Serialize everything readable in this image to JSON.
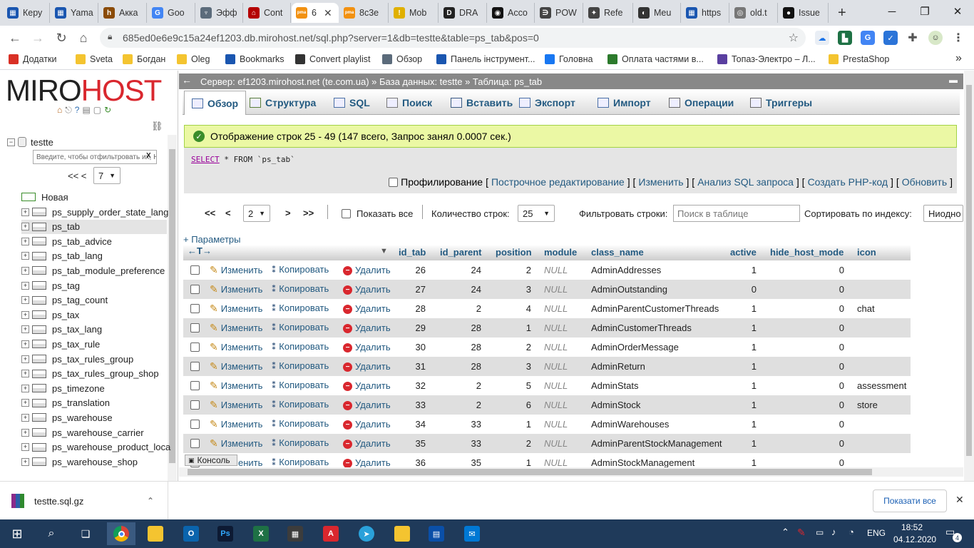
{
  "browser": {
    "tabs": [
      {
        "label": "Керу",
        "icon_color": "#1a56b0",
        "icon_char": "▦"
      },
      {
        "label": "Yama",
        "icon_color": "#1a56b0",
        "icon_char": "▦"
      },
      {
        "label": "Акка",
        "icon_color": "#8a4b08",
        "icon_char": "h"
      },
      {
        "label": "Goo",
        "icon_color": "#4285f4",
        "icon_char": "G"
      },
      {
        "label": "Эфф",
        "icon_color": "#5b6b7b",
        "icon_char": "♆"
      },
      {
        "label": "Cont",
        "icon_color": "#b40000",
        "icon_char": "⌂"
      },
      {
        "label": "6",
        "icon_color": "#f29111",
        "icon_char": "pma"
      },
      {
        "label": "8с3е",
        "icon_color": "#f29111",
        "icon_char": "pma"
      },
      {
        "label": "Mob",
        "icon_color": "#e0b000",
        "icon_char": "!"
      },
      {
        "label": "DRA",
        "icon_color": "#222222",
        "icon_char": "D"
      },
      {
        "label": "Acco",
        "icon_color": "#111111",
        "icon_char": "◉"
      },
      {
        "label": "POW",
        "icon_color": "#444444",
        "icon_char": "∋"
      },
      {
        "label": "Refe",
        "icon_color": "#444444",
        "icon_char": "✦"
      },
      {
        "label": "Meu",
        "icon_color": "#333333",
        "icon_char": "◐"
      },
      {
        "label": "https",
        "icon_color": "#1a56b0",
        "icon_char": "▦"
      },
      {
        "label": "old.t",
        "icon_color": "#777777",
        "icon_char": "◎"
      },
      {
        "label": "Issue",
        "icon_color": "#111111",
        "icon_char": "●"
      }
    ],
    "new_tab": "+",
    "url": "685ed0e6e9c15a24ef1203.db.mirohost.net/sql.php?server=1&db=testte&table=ps_tab&pos=0",
    "bookmarks": [
      {
        "label": "Додатки",
        "color": "#d93025"
      },
      {
        "label": "Sveta",
        "color": "#f4c430"
      },
      {
        "label": "Богдан",
        "color": "#f4c430"
      },
      {
        "label": "Oleg",
        "color": "#f4c430"
      },
      {
        "label": "Bookmarks",
        "color": "#1a56b0"
      },
      {
        "label": "Convert playlist",
        "color": "#333333"
      },
      {
        "label": "Обзор",
        "color": "#5b6b7b"
      },
      {
        "label": "Панель інструмент...",
        "color": "#1a56b0"
      },
      {
        "label": "Головна",
        "color": "#1877f2"
      },
      {
        "label": "Оплата частями в...",
        "color": "#2c7a2c"
      },
      {
        "label": "Топаз-Электро – Л...",
        "color": "#5a3fa0"
      },
      {
        "label": "PrestaShop",
        "color": "#f4c430"
      }
    ],
    "more_bookmarks": "»"
  },
  "nav": {
    "logo_a": "MIRO",
    "logo_b": "HOST",
    "db_name": "testte",
    "filter_placeholder": "Введите, чтобы отфильтровать их, Н",
    "filter_clear": "X",
    "page_prev": "<< <",
    "page_select": "7",
    "new_label": "Новая",
    "tables": [
      "ps_supply_order_state_lang",
      "ps_tab",
      "ps_tab_advice",
      "ps_tab_lang",
      "ps_tab_module_preference",
      "ps_tag",
      "ps_tag_count",
      "ps_tax",
      "ps_tax_lang",
      "ps_tax_rule",
      "ps_tax_rules_group",
      "ps_tax_rules_group_shop",
      "ps_timezone",
      "ps_translation",
      "ps_warehouse",
      "ps_warehouse_carrier",
      "ps_warehouse_product_loca",
      "ps_warehouse_shop"
    ]
  },
  "pma": {
    "breadcrumb": "Сервер: ef1203.mirohost.net (te.com.ua) » База данных: testte » Таблица: ps_tab",
    "tabs": [
      "Обзор",
      "Структура",
      "SQL",
      "Поиск",
      "Вставить",
      "Экспорт",
      "Импорт",
      "Операции",
      "Триггеры"
    ],
    "success": "Отображение строк 25 - 49 (147 всего, Запрос занял 0.0007 сек.)",
    "sql_select": "SELECT",
    "sql_rest": " * FROM `ps_tab`",
    "profiling": "Профилирование",
    "links": [
      "Построчное редактирование",
      "Изменить",
      "Анализ SQL запроса",
      "Создать PHP-код",
      "Обновить"
    ],
    "nav": {
      "first": "<<",
      "prev": "<",
      "page": "2",
      "next": ">",
      "last": ">>",
      "show_all": "Показать все",
      "rows_label": "Количество строк:",
      "rows_value": "25",
      "filter_label": "Фильтровать строки:",
      "filter_placeholder": "Поиск в таблице",
      "sort_label": "Сортировать по индексу:",
      "sort_value": "Ниодно"
    },
    "params": "+ Параметры",
    "columns": [
      "id_tab",
      "id_parent",
      "position",
      "module",
      "class_name",
      "active",
      "hide_host_mode",
      "icon"
    ],
    "action_edit": "Изменить",
    "action_copy": "Копировать",
    "action_delete": "Удалить",
    "rows": [
      {
        "id_tab": "26",
        "id_parent": "24",
        "position": "2",
        "module": "NULL",
        "class_name": "AdminAddresses",
        "active": "1",
        "hide_host_mode": "0",
        "icon": ""
      },
      {
        "id_tab": "27",
        "id_parent": "24",
        "position": "3",
        "module": "NULL",
        "class_name": "AdminOutstanding",
        "active": "0",
        "hide_host_mode": "0",
        "icon": ""
      },
      {
        "id_tab": "28",
        "id_parent": "2",
        "position": "4",
        "module": "NULL",
        "class_name": "AdminParentCustomerThreads",
        "active": "1",
        "hide_host_mode": "0",
        "icon": "chat"
      },
      {
        "id_tab": "29",
        "id_parent": "28",
        "position": "1",
        "module": "NULL",
        "class_name": "AdminCustomerThreads",
        "active": "1",
        "hide_host_mode": "0",
        "icon": ""
      },
      {
        "id_tab": "30",
        "id_parent": "28",
        "position": "2",
        "module": "NULL",
        "class_name": "AdminOrderMessage",
        "active": "1",
        "hide_host_mode": "0",
        "icon": ""
      },
      {
        "id_tab": "31",
        "id_parent": "28",
        "position": "3",
        "module": "NULL",
        "class_name": "AdminReturn",
        "active": "1",
        "hide_host_mode": "0",
        "icon": ""
      },
      {
        "id_tab": "32",
        "id_parent": "2",
        "position": "5",
        "module": "NULL",
        "class_name": "AdminStats",
        "active": "1",
        "hide_host_mode": "0",
        "icon": "assessment"
      },
      {
        "id_tab": "33",
        "id_parent": "2",
        "position": "6",
        "module": "NULL",
        "class_name": "AdminStock",
        "active": "1",
        "hide_host_mode": "0",
        "icon": "store"
      },
      {
        "id_tab": "34",
        "id_parent": "33",
        "position": "1",
        "module": "NULL",
        "class_name": "AdminWarehouses",
        "active": "1",
        "hide_host_mode": "0",
        "icon": ""
      },
      {
        "id_tab": "35",
        "id_parent": "33",
        "position": "2",
        "module": "NULL",
        "class_name": "AdminParentStockManagement",
        "active": "1",
        "hide_host_mode": "0",
        "icon": ""
      },
      {
        "id_tab": "36",
        "id_parent": "35",
        "position": "1",
        "module": "NULL",
        "class_name": "AdminStockManagement",
        "active": "1",
        "hide_host_mode": "0",
        "icon": ""
      }
    ],
    "console": "Консоль"
  },
  "download": {
    "filename": "testte.sql.gz",
    "show_all": "Показати все",
    "close": "✕"
  },
  "taskbar": {
    "lang": "ENG",
    "time": "18:52",
    "date": "04.12.2020",
    "notif_count": "4"
  }
}
